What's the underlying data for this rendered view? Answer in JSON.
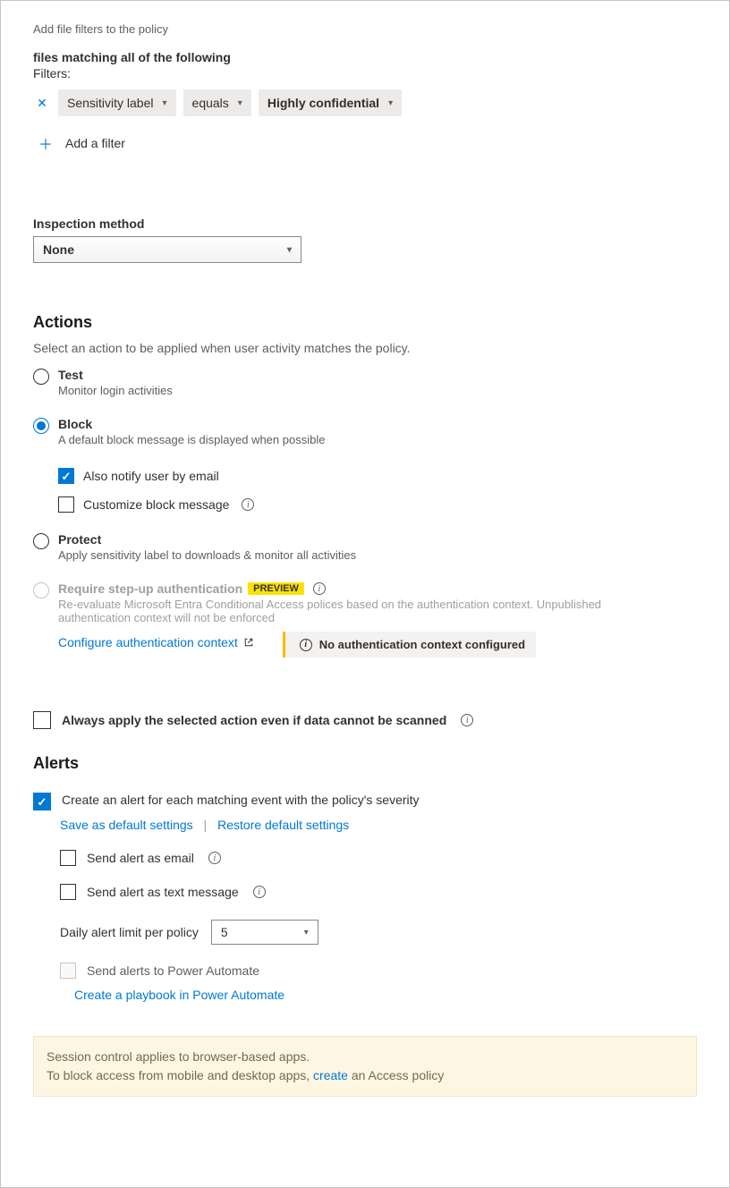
{
  "filters": {
    "header": "Add file filters to the policy",
    "matching": "files matching all of the following",
    "label": "Filters:",
    "row": {
      "field": "Sensitivity label",
      "operator": "equals",
      "value": "Highly confidential"
    },
    "add": "Add a filter"
  },
  "inspection": {
    "label": "Inspection method",
    "value": "None"
  },
  "actions": {
    "heading": "Actions",
    "subtitle": "Select an action to be applied when user activity matches the policy.",
    "test": {
      "label": "Test",
      "desc": "Monitor login activities"
    },
    "block": {
      "label": "Block",
      "desc": "A default block message is displayed when possible",
      "notify": "Also notify user by email",
      "customize": "Customize block message"
    },
    "protect": {
      "label": "Protect",
      "desc": "Apply sensitivity label to downloads & monitor all activities"
    },
    "stepup": {
      "label": "Require step-up authentication",
      "badge": "PREVIEW",
      "desc": "Re-evaluate Microsoft Entra Conditional Access polices based on the authentication context. Unpublished authentication context will not be enforced",
      "config_link": "Configure authentication context",
      "warn": "No authentication context configured"
    },
    "always_apply": "Always apply the selected action even if data cannot be scanned"
  },
  "alerts": {
    "heading": "Alerts",
    "create_alert": "Create an alert for each matching event with the policy's severity",
    "save_default": "Save as default settings",
    "restore_default": "Restore default settings",
    "send_email": "Send alert as email",
    "send_text": "Send alert as text message",
    "daily_limit_label": "Daily alert limit per policy",
    "daily_limit_value": "5",
    "power_automate": "Send alerts to Power Automate",
    "playbook_link": "Create a playbook in Power Automate"
  },
  "footer": {
    "line1": "Session control applies to browser-based apps.",
    "line2a": "To block access from mobile and desktop apps, ",
    "link": "create",
    "line2b": " an Access policy"
  }
}
